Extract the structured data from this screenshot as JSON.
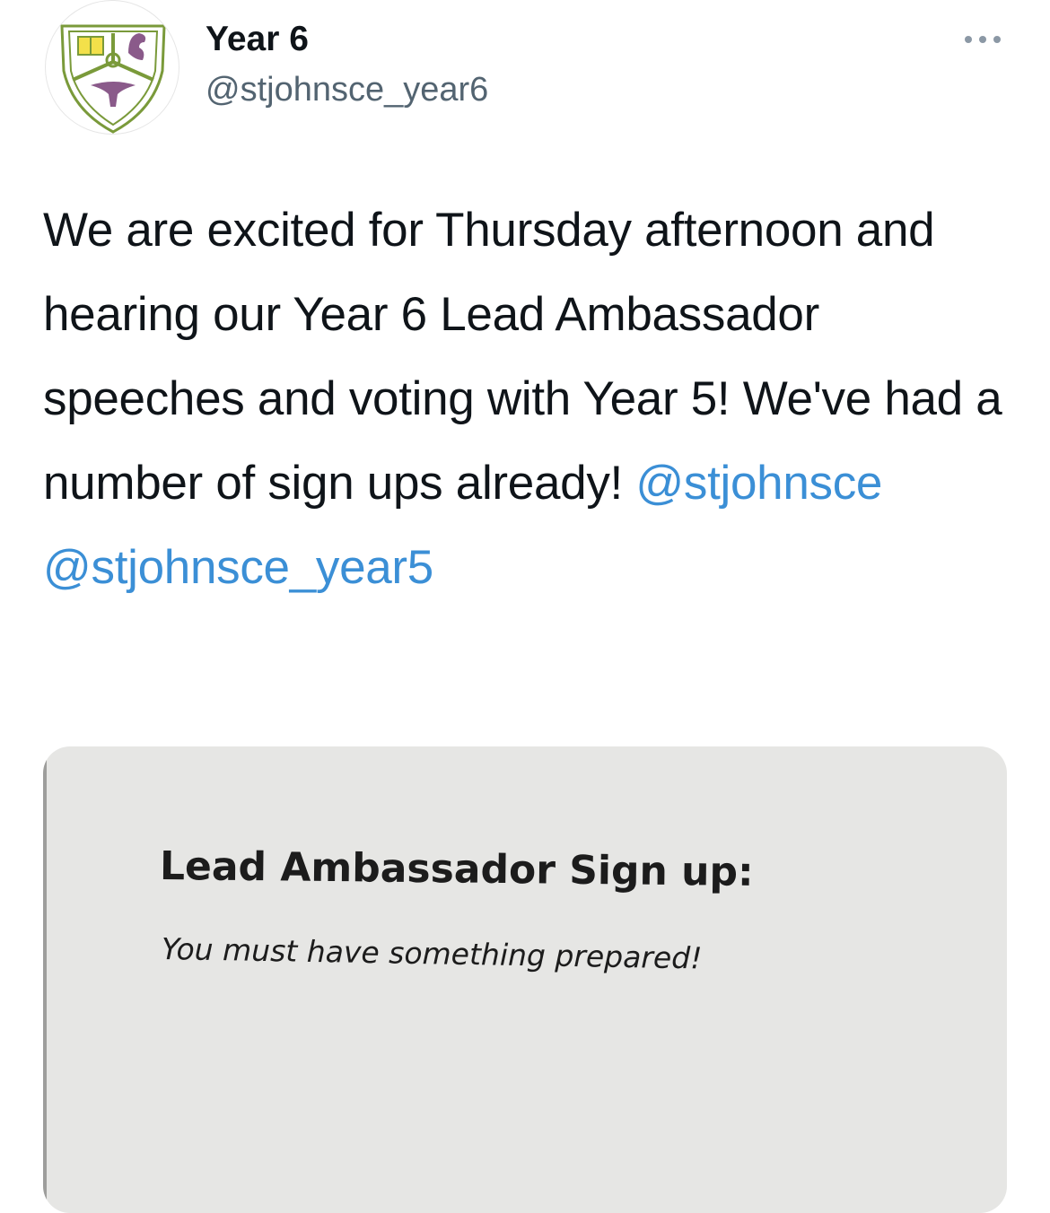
{
  "tweet": {
    "author": {
      "display_name": "Year 6",
      "handle": "@stjohnsce_year6",
      "avatar_icon": "school-crest-icon"
    },
    "more_icon": "ellipsis-icon",
    "text_parts": [
      "We are excited for Thursday afternoon and hearing our Year 6 Lead Ambassador speeches and voting with Year 5! We've had a number of sign ups already! ",
      "@stjohnsce",
      " ",
      "@stjohnsce_year5"
    ],
    "mention_color": "#3b8fd6",
    "media": {
      "paper_title": "Lead Ambassador Sign up:",
      "paper_subtitle": "You must have something prepared!"
    }
  }
}
